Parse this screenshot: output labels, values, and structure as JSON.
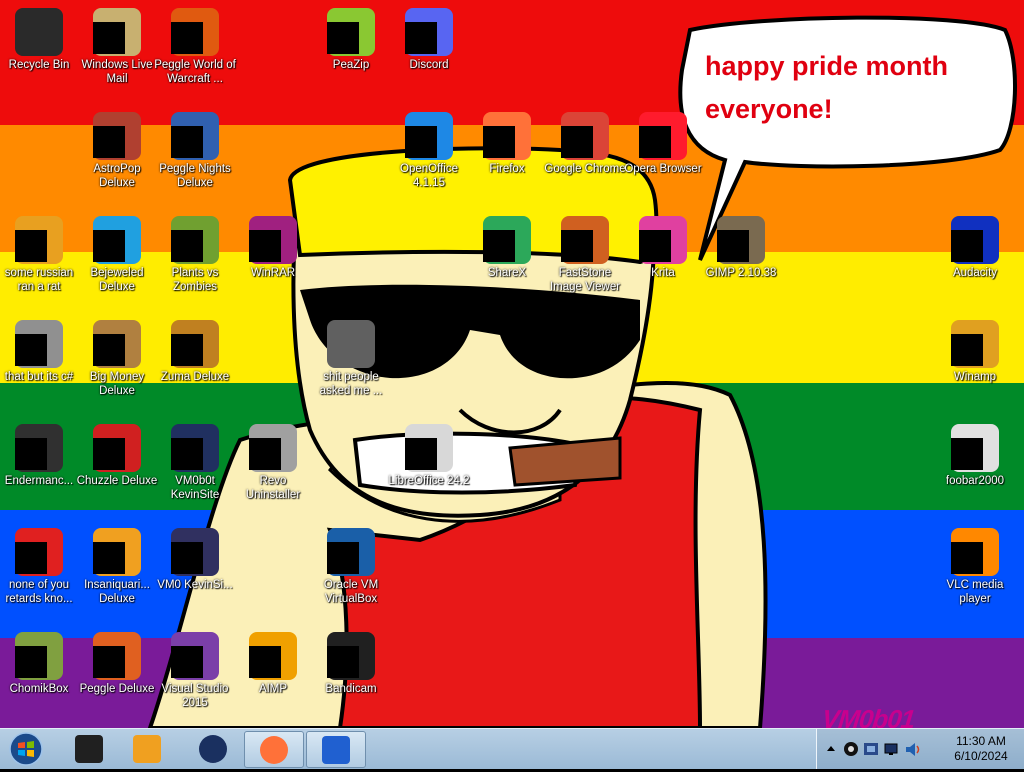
{
  "wallpaper": {
    "stripe_colors": [
      "#ee0c0c",
      "#ff8a00",
      "#ffed00",
      "#008a28",
      "#0050ff",
      "#7a1b99"
    ],
    "speech_bubble_line1": "happy pride month",
    "speech_bubble_line2": "everyone!",
    "corner_tag": "VM0b01"
  },
  "desktop": {
    "icons": [
      {
        "label": "Recycle Bin",
        "icon": "recycle-bin-icon",
        "color": "#2a2a2a",
        "covered": false
      },
      {
        "label": "Windows Live Mail",
        "icon": "mail-icon",
        "color": "#c8b070",
        "covered": true
      },
      {
        "label": "Peggle World of Warcraft ...",
        "icon": "peggle-icon",
        "color": "#e05a10",
        "covered": true
      },
      {
        "label": "PeaZip",
        "icon": "peazip-icon",
        "color": "#8ac832",
        "covered": true
      },
      {
        "label": "Discord",
        "icon": "discord-icon",
        "color": "#5865f2",
        "covered": true
      },
      {
        "label": "AstroPop Deluxe",
        "icon": "astropop-icon",
        "color": "#b04030",
        "covered": true
      },
      {
        "label": "Peggle Nights Deluxe",
        "icon": "peggle-nights-icon",
        "color": "#3060b0",
        "covered": true
      },
      {
        "label": "OpenOffice 4.1.15",
        "icon": "openoffice-icon",
        "color": "#1e88e5",
        "covered": true
      },
      {
        "label": "Firefox",
        "icon": "firefox-icon",
        "color": "#ff7139",
        "covered": true
      },
      {
        "label": "Google Chrome",
        "icon": "chrome-icon",
        "color": "#db4437",
        "covered": true
      },
      {
        "label": "Opera Browser",
        "icon": "opera-icon",
        "color": "#ff1b2d",
        "covered": true
      },
      {
        "label": "some russian ran a rat",
        "icon": "file-icon",
        "color": "#e8a020",
        "covered": true
      },
      {
        "label": "Bejeweled Deluxe",
        "icon": "bejeweled-icon",
        "color": "#20a0e0",
        "covered": true
      },
      {
        "label": "Plants vs Zombies",
        "icon": "pvz-icon",
        "color": "#70a030",
        "covered": true
      },
      {
        "label": "WinRAR",
        "icon": "winrar-icon",
        "color": "#a02080",
        "covered": true
      },
      {
        "label": "ShareX",
        "icon": "sharex-icon",
        "color": "#2ca85a",
        "covered": true
      },
      {
        "label": "FastStone Image Viewer",
        "icon": "faststone-icon",
        "color": "#d06020",
        "covered": true
      },
      {
        "label": "Krita",
        "icon": "krita-icon",
        "color": "#e040a0",
        "covered": true
      },
      {
        "label": "GIMP 2.10.38",
        "icon": "gimp-icon",
        "color": "#7a6a50",
        "covered": true
      },
      {
        "label": "Audacity",
        "icon": "audacity-icon",
        "color": "#1030c0",
        "covered": true
      },
      {
        "label": "that but its c#",
        "icon": "file-icon",
        "color": "#909090",
        "covered": true
      },
      {
        "label": "Big Money Deluxe",
        "icon": "bigmoney-icon",
        "color": "#b08040",
        "covered": true
      },
      {
        "label": "Zuma Deluxe",
        "icon": "zuma-icon",
        "color": "#c08020",
        "covered": true
      },
      {
        "label": "shit people asked me ...",
        "icon": "folder-icon",
        "color": "#606060",
        "covered": false
      },
      {
        "label": "Winamp",
        "icon": "winamp-icon",
        "color": "#e0a020",
        "covered": true
      },
      {
        "label": "Endermanc...",
        "icon": "app-icon",
        "color": "#303030",
        "covered": true
      },
      {
        "label": "Chuzzle Deluxe",
        "icon": "chuzzle-icon",
        "color": "#d02020",
        "covered": true
      },
      {
        "label": "VM0b0t KevinSite",
        "icon": "app-icon",
        "color": "#203060",
        "covered": true
      },
      {
        "label": "Revo Uninstaller",
        "icon": "revo-icon",
        "color": "#a0a0a0",
        "covered": true
      },
      {
        "label": "LibreOffice 24.2",
        "icon": "libreoffice-icon",
        "color": "#d8d8d8",
        "covered": true
      },
      {
        "label": "foobar2000",
        "icon": "foobar-icon",
        "color": "#e0e0e0",
        "covered": true
      },
      {
        "label": "none of you retards kno...",
        "icon": "file-icon",
        "color": "#e02020",
        "covered": true
      },
      {
        "label": "Insaniquari... Deluxe",
        "icon": "insaniquarium-icon",
        "color": "#f0a020",
        "covered": true
      },
      {
        "label": "VM0 KevinSi...",
        "icon": "app-icon",
        "color": "#303060",
        "covered": true
      },
      {
        "label": "Oracle VM VirtualBox",
        "icon": "virtualbox-icon",
        "color": "#1a5fa8",
        "covered": true
      },
      {
        "label": "VLC media player",
        "icon": "vlc-icon",
        "color": "#ff8800",
        "covered": true
      },
      {
        "label": "ChomikBox",
        "icon": "chomikbox-icon",
        "color": "#80a040",
        "covered": true
      },
      {
        "label": "Peggle Deluxe",
        "icon": "peggle-deluxe-icon",
        "color": "#e06020",
        "covered": true
      },
      {
        "label": "Visual Studio 2015",
        "icon": "visual-studio-icon",
        "color": "#7b3fa8",
        "covered": true
      },
      {
        "label": "AIMP",
        "icon": "aimp-icon",
        "color": "#f0a000",
        "covered": true
      },
      {
        "label": "Bandicam",
        "icon": "bandicam-icon",
        "color": "#202020",
        "covered": true
      }
    ]
  },
  "taskbar": {
    "start_icon": "windows-start-icon",
    "pinned": [
      {
        "icon": "cmd-icon",
        "color": "#202020"
      },
      {
        "icon": "media-player-icon",
        "color": "#f0a020"
      },
      {
        "icon": "globe-icon",
        "color": "#1a3060"
      },
      {
        "icon": "firefox-icon",
        "color": "#ff7139"
      },
      {
        "icon": "app-icon",
        "color": "#2060d0"
      }
    ],
    "tray": {
      "clock_time": "11:30 AM",
      "clock_date": "6/10/2024"
    }
  }
}
